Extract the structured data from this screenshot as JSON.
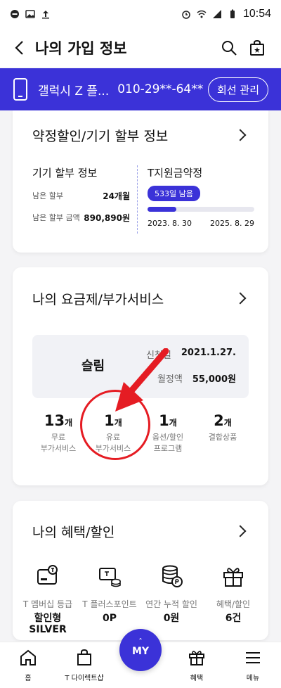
{
  "status": {
    "time": "10:54"
  },
  "appbar": {
    "title": "나의 가입 정보"
  },
  "line": {
    "device": "갤럭시 Z 플...",
    "number": "010-29**-64**",
    "manage": "회선 관리"
  },
  "contract": {
    "title": "약정할인/기기 할부 정보",
    "installment": {
      "header": "기기 할부 정보",
      "remaining_label": "남은 할부",
      "remaining_value": "24개월",
      "amount_label": "남은 할부 금액",
      "amount_value": "890,890원"
    },
    "support": {
      "header": "T지원금약정",
      "days_left": "533일 남음",
      "progress": 0.27,
      "start": "2023. 8. 30",
      "end": "2025. 8. 29"
    }
  },
  "plan": {
    "title": "나의 요금제/부가서비스",
    "name": "슬림",
    "apply_label": "신청일",
    "apply_value": "2021.1.27.",
    "fee_label": "월정액",
    "fee_value": "55,000원",
    "stats": [
      {
        "num": "13",
        "unit": "개",
        "label1": "무료",
        "label2": "부가서비스"
      },
      {
        "num": "1",
        "unit": "개",
        "label1": "유료",
        "label2": "부가서비스"
      },
      {
        "num": "1",
        "unit": "개",
        "label1": "옵션/할인",
        "label2": "프로그램"
      },
      {
        "num": "2",
        "unit": "개",
        "label1": "결합상품",
        "label2": ""
      }
    ]
  },
  "benefits": {
    "title": "나의 혜택/할인",
    "items": [
      {
        "label": "T 멤버십 등급",
        "value": "할인형",
        "value2": "SILVER",
        "icon": "membership-card-icon"
      },
      {
        "label": "T 플러스포인트",
        "value": "0P",
        "value2": "",
        "icon": "points-icon"
      },
      {
        "label": "연간 누적 할인",
        "value": "0원",
        "value2": "",
        "icon": "coin-stack-icon"
      },
      {
        "label": "혜택/할인",
        "value": "6건",
        "value2": "",
        "icon": "gift-icon"
      }
    ]
  },
  "nav": {
    "home": "홈",
    "shop": "T 다이렉트샵",
    "my": "MY",
    "benefit": "혜택",
    "menu": "메뉴"
  },
  "colors": {
    "brand": "#3b32d8",
    "annotation": "#e51c23"
  }
}
